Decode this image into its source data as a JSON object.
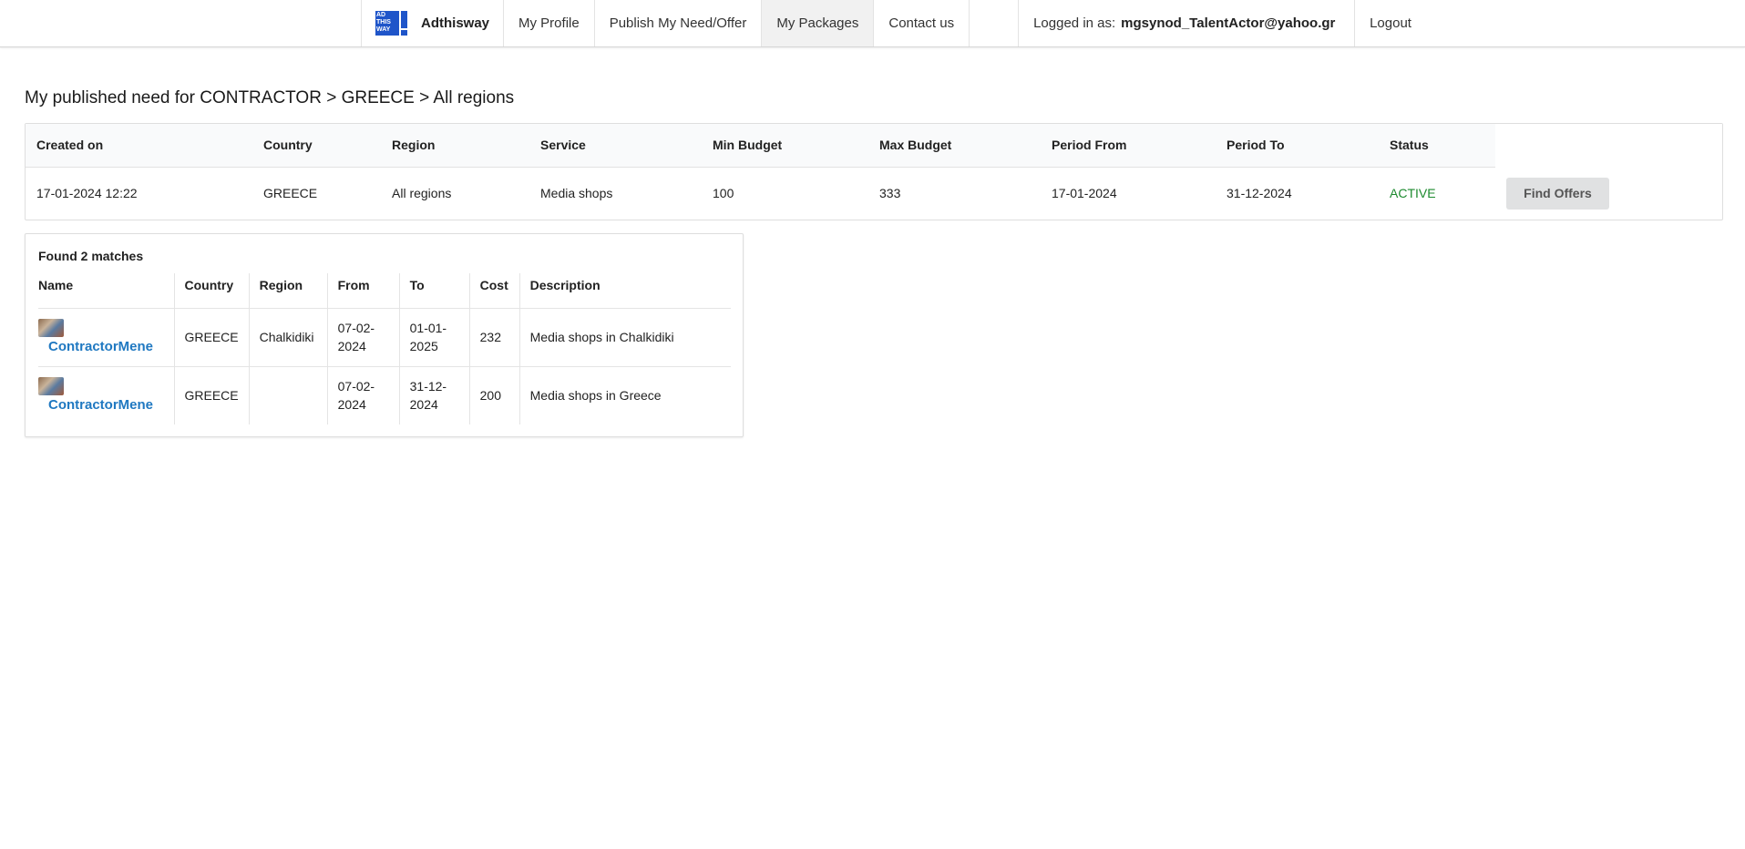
{
  "nav": {
    "brand": "Adthisway",
    "logo_text": [
      "AD",
      "THIS",
      "WAY"
    ],
    "items": [
      {
        "key": "profile",
        "label": "My Profile"
      },
      {
        "key": "publish",
        "label": "Publish My Need/Offer"
      },
      {
        "key": "packages",
        "label": "My Packages",
        "active": true
      },
      {
        "key": "contact",
        "label": "Contact us"
      }
    ],
    "logged_in_label": "Logged in as:",
    "logged_in_email": "mgsynod_TalentActor@yahoo.gr",
    "logout": "Logout"
  },
  "page": {
    "title": "My published need for CONTRACTOR > GREECE > All regions"
  },
  "need": {
    "headers": [
      "Created on",
      "Country",
      "Region",
      "Service",
      "Min Budget",
      "Max Budget",
      "Period From",
      "Period To",
      "Status"
    ],
    "row": {
      "created_on": "17-01-2024 12:22",
      "country": "GREECE",
      "region": "All regions",
      "service": "Media shops",
      "min_budget": "100",
      "max_budget": "333",
      "period_from": "17-01-2024",
      "period_to": "31-12-2024",
      "status": "ACTIVE"
    },
    "find_button": "Find Offers",
    "status_color": "#1c8a2e"
  },
  "matches": {
    "title": "Found 2 matches",
    "headers": [
      "Name",
      "Country",
      "Region",
      "From",
      "To",
      "Cost",
      "Description"
    ],
    "rows": [
      {
        "name": "ContractorMene",
        "country": "GREECE",
        "region": "Chalkidiki",
        "from": "07-02-2024",
        "to": "01-01-2025",
        "cost": "232",
        "description": "Media shops in Chalkidiki"
      },
      {
        "name": "ContractorMene",
        "country": "GREECE",
        "region": "",
        "from": "07-02-2024",
        "to": "31-12-2024",
        "cost": "200",
        "description": "Media shops in Greece"
      }
    ]
  },
  "colors": {
    "link": "#1f78c1",
    "brand_blue": "#1f55c9"
  }
}
